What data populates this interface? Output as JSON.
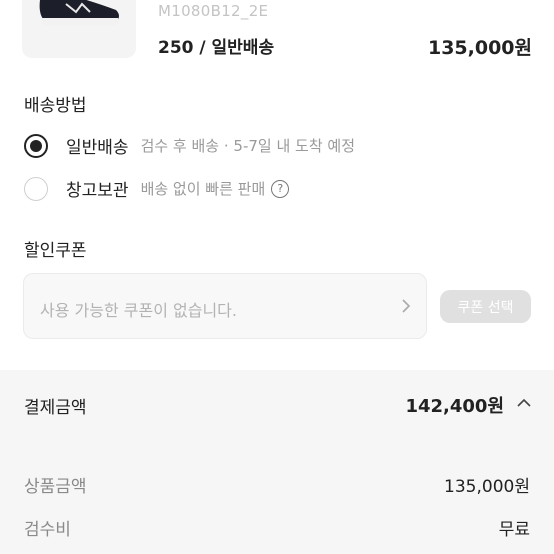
{
  "product": {
    "model": "M1080B12_2E",
    "option": "250 / 일반배송",
    "price": "135,000원",
    "image_icon": "sneaker-image"
  },
  "delivery": {
    "title": "배송방법",
    "options": [
      {
        "label": "일반배송",
        "desc": "검수 후 배송 · 5-7일 내 도착 예정",
        "selected": true
      },
      {
        "label": "창고보관",
        "desc": "배송 없이 빠른 판매",
        "selected": false,
        "icon": "help-icon"
      }
    ]
  },
  "coupon": {
    "title": "할인쿠폰",
    "placeholder": "사용 가능한 쿠폰이 없습니다.",
    "button": "쿠폰 선택"
  },
  "summary": {
    "title": "결제금액",
    "total": "142,400원",
    "rows": [
      {
        "label": "상품금액",
        "value": "135,000원"
      },
      {
        "label": "검수비",
        "value": "무료"
      }
    ]
  },
  "colors": {
    "accent": "#222222",
    "muted": "#9a9a9a",
    "disabled_button": "#e0e0e0",
    "summary_bg": "#f6f6f6"
  }
}
